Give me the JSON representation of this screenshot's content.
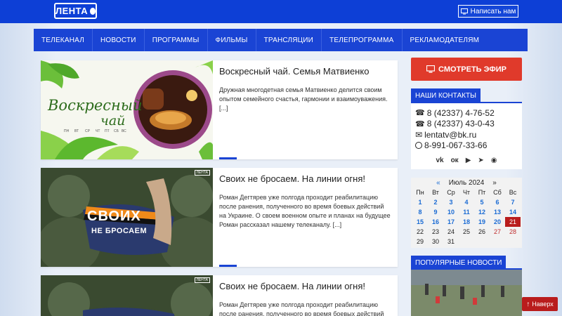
{
  "header": {
    "logo_text": "ЛЕНТА",
    "write_button": "Написать нам"
  },
  "nav": {
    "items": [
      "ТЕЛЕКАНАЛ",
      "НОВОСТИ",
      "ПРОГРАММЫ",
      "ФИЛЬМЫ",
      "ТРАНСЛЯЦИИ",
      "ТЕЛЕПРОГРАММА",
      "РЕКЛАМОДАТЕЛЯМ"
    ]
  },
  "articles": [
    {
      "title": "Воскресный чай. Семья Матвиенко",
      "desc": "Дружная многодетная семья Матвиенко делится своим опытом семейного счастья, гармонии и взаимоуважения. [...]",
      "thumb_text_1": "Воскресный",
      "thumb_text_2": "чай"
    },
    {
      "title": "Своих не бросаем. На линии огня!",
      "desc": "Роман Дегтярев уже полгода проходит реабилитацию после ранения, полученного во время боевых действий на Украине. О своем военном опыте и планах на будущее Роман рассказал нашему телеканалу. [...]",
      "thumb_text_1": "СВОИХ",
      "thumb_text_2": "НЕ БРОСАЕМ",
      "thumb_badge": "ЛЕНТА"
    },
    {
      "title": "Своих не бросаем. На линии огня!",
      "desc": "Роман Дегтярев уже полгода проходит реабилитацию после ранения, полученного во время боевых действий на",
      "thumb_badge": "ЛЕНТА"
    }
  ],
  "sidebar": {
    "live_button": "СМОТРЕТЬ ЭФИР",
    "contacts_title": "НАШИ КОНТАКТЫ",
    "contacts": [
      {
        "icon": "phone-icon",
        "text": "8 (42337) 4-76-52"
      },
      {
        "icon": "phone-icon",
        "text": "8 (42337) 43-0-43"
      },
      {
        "icon": "mail-icon",
        "text": "lentatv@bk.ru"
      },
      {
        "icon": "whatsapp-icon",
        "text": "8-991-067-33-66"
      }
    ],
    "socials": [
      "vk-icon",
      "ok-icon",
      "youtube-icon",
      "telegram-icon",
      "rss-icon"
    ],
    "calendar": {
      "prev": "«",
      "month": "Июль 2024",
      "next": "»",
      "days_of_week": [
        "Пн",
        "Вт",
        "Ср",
        "Чт",
        "Пт",
        "Сб",
        "Вс"
      ],
      "weeks": [
        [
          "1",
          "2",
          "3",
          "4",
          "5",
          "6",
          "7"
        ],
        [
          "8",
          "9",
          "10",
          "11",
          "12",
          "13",
          "14"
        ],
        [
          "15",
          "16",
          "17",
          "18",
          "19",
          "20",
          "21"
        ],
        [
          "22",
          "23",
          "24",
          "25",
          "26",
          "27",
          "28"
        ],
        [
          "29",
          "30",
          "31",
          "",
          "",
          "",
          ""
        ]
      ],
      "today": "21"
    },
    "popular_title": "ПОПУЛЯРНЫЕ НОВОСТИ"
  },
  "back_to_top": "Наверх",
  "colors": {
    "brand_blue": "#1a44d4",
    "live_red": "#e03a2b",
    "today_red": "#b91c1c"
  }
}
